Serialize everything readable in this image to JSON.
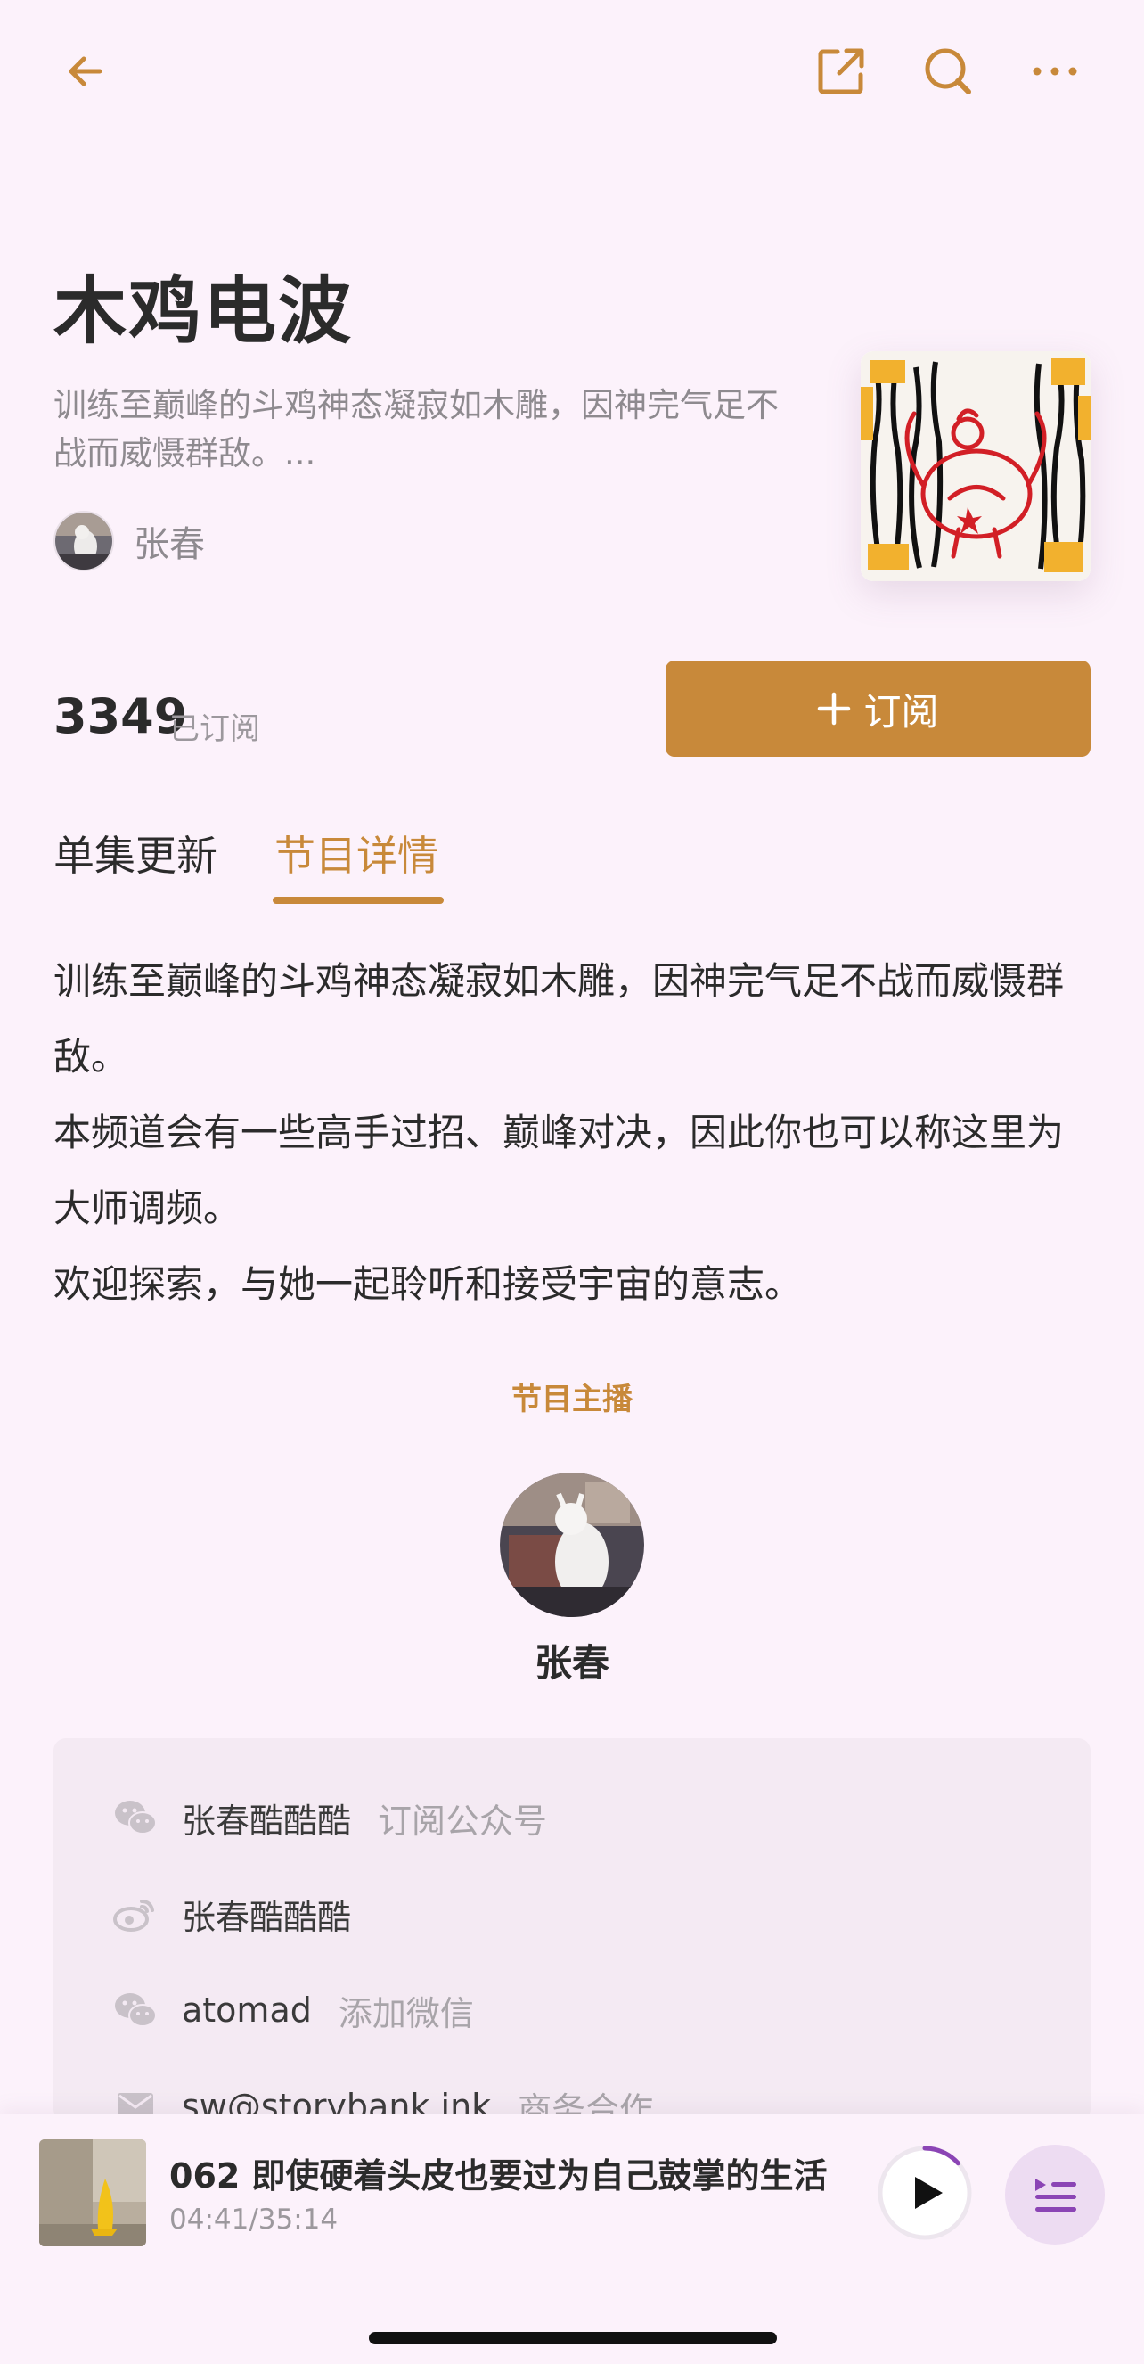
{
  "header": {
    "back_icon": "arrow-left-icon",
    "share_icon": "share-external-icon",
    "search_icon": "search-icon",
    "more_icon": "more-dots-icon"
  },
  "podcast": {
    "title": "木鸡电波",
    "summary": "训练至巅峰的斗鸡神态凝寂如木雕，因神完气足不战而威慑群敌。...",
    "host_name": "张春",
    "subscriber_count": "3349",
    "subscriber_label": "已订阅",
    "subscribe_label": "订阅"
  },
  "tabs": [
    {
      "label": "单集更新",
      "active": false
    },
    {
      "label": "节目详情",
      "active": true
    }
  ],
  "description": [
    "训练至巅峰的斗鸡神态凝寂如木雕，因神完气足不战而威慑群敌。",
    "本频道会有一些高手过招、巅峰对决，因此你也可以称这里为大师调频。",
    "欢迎探索，与她一起聆听和接受宇宙的意志。"
  ],
  "host_section": {
    "title": "节目主播",
    "host_name": "张春"
  },
  "contacts": [
    {
      "icon": "wechat-icon",
      "name": "张春酷酷酷",
      "action": "订阅公众号"
    },
    {
      "icon": "weibo-icon",
      "name": "张春酷酷酷",
      "action": ""
    },
    {
      "icon": "wechat-icon",
      "name": "atomad",
      "action": "添加微信"
    },
    {
      "icon": "mail-icon",
      "name": "sw@storybank.ink",
      "action": "商务合作"
    }
  ],
  "player": {
    "title": "062 即使硬着头皮也要过为自己鼓掌的生活",
    "time": "04:41/35:14",
    "progress": 0.134
  },
  "colors": {
    "accent": "#C8893A",
    "background": "#FCF2FB",
    "queue_purple": "#8B45B5"
  }
}
